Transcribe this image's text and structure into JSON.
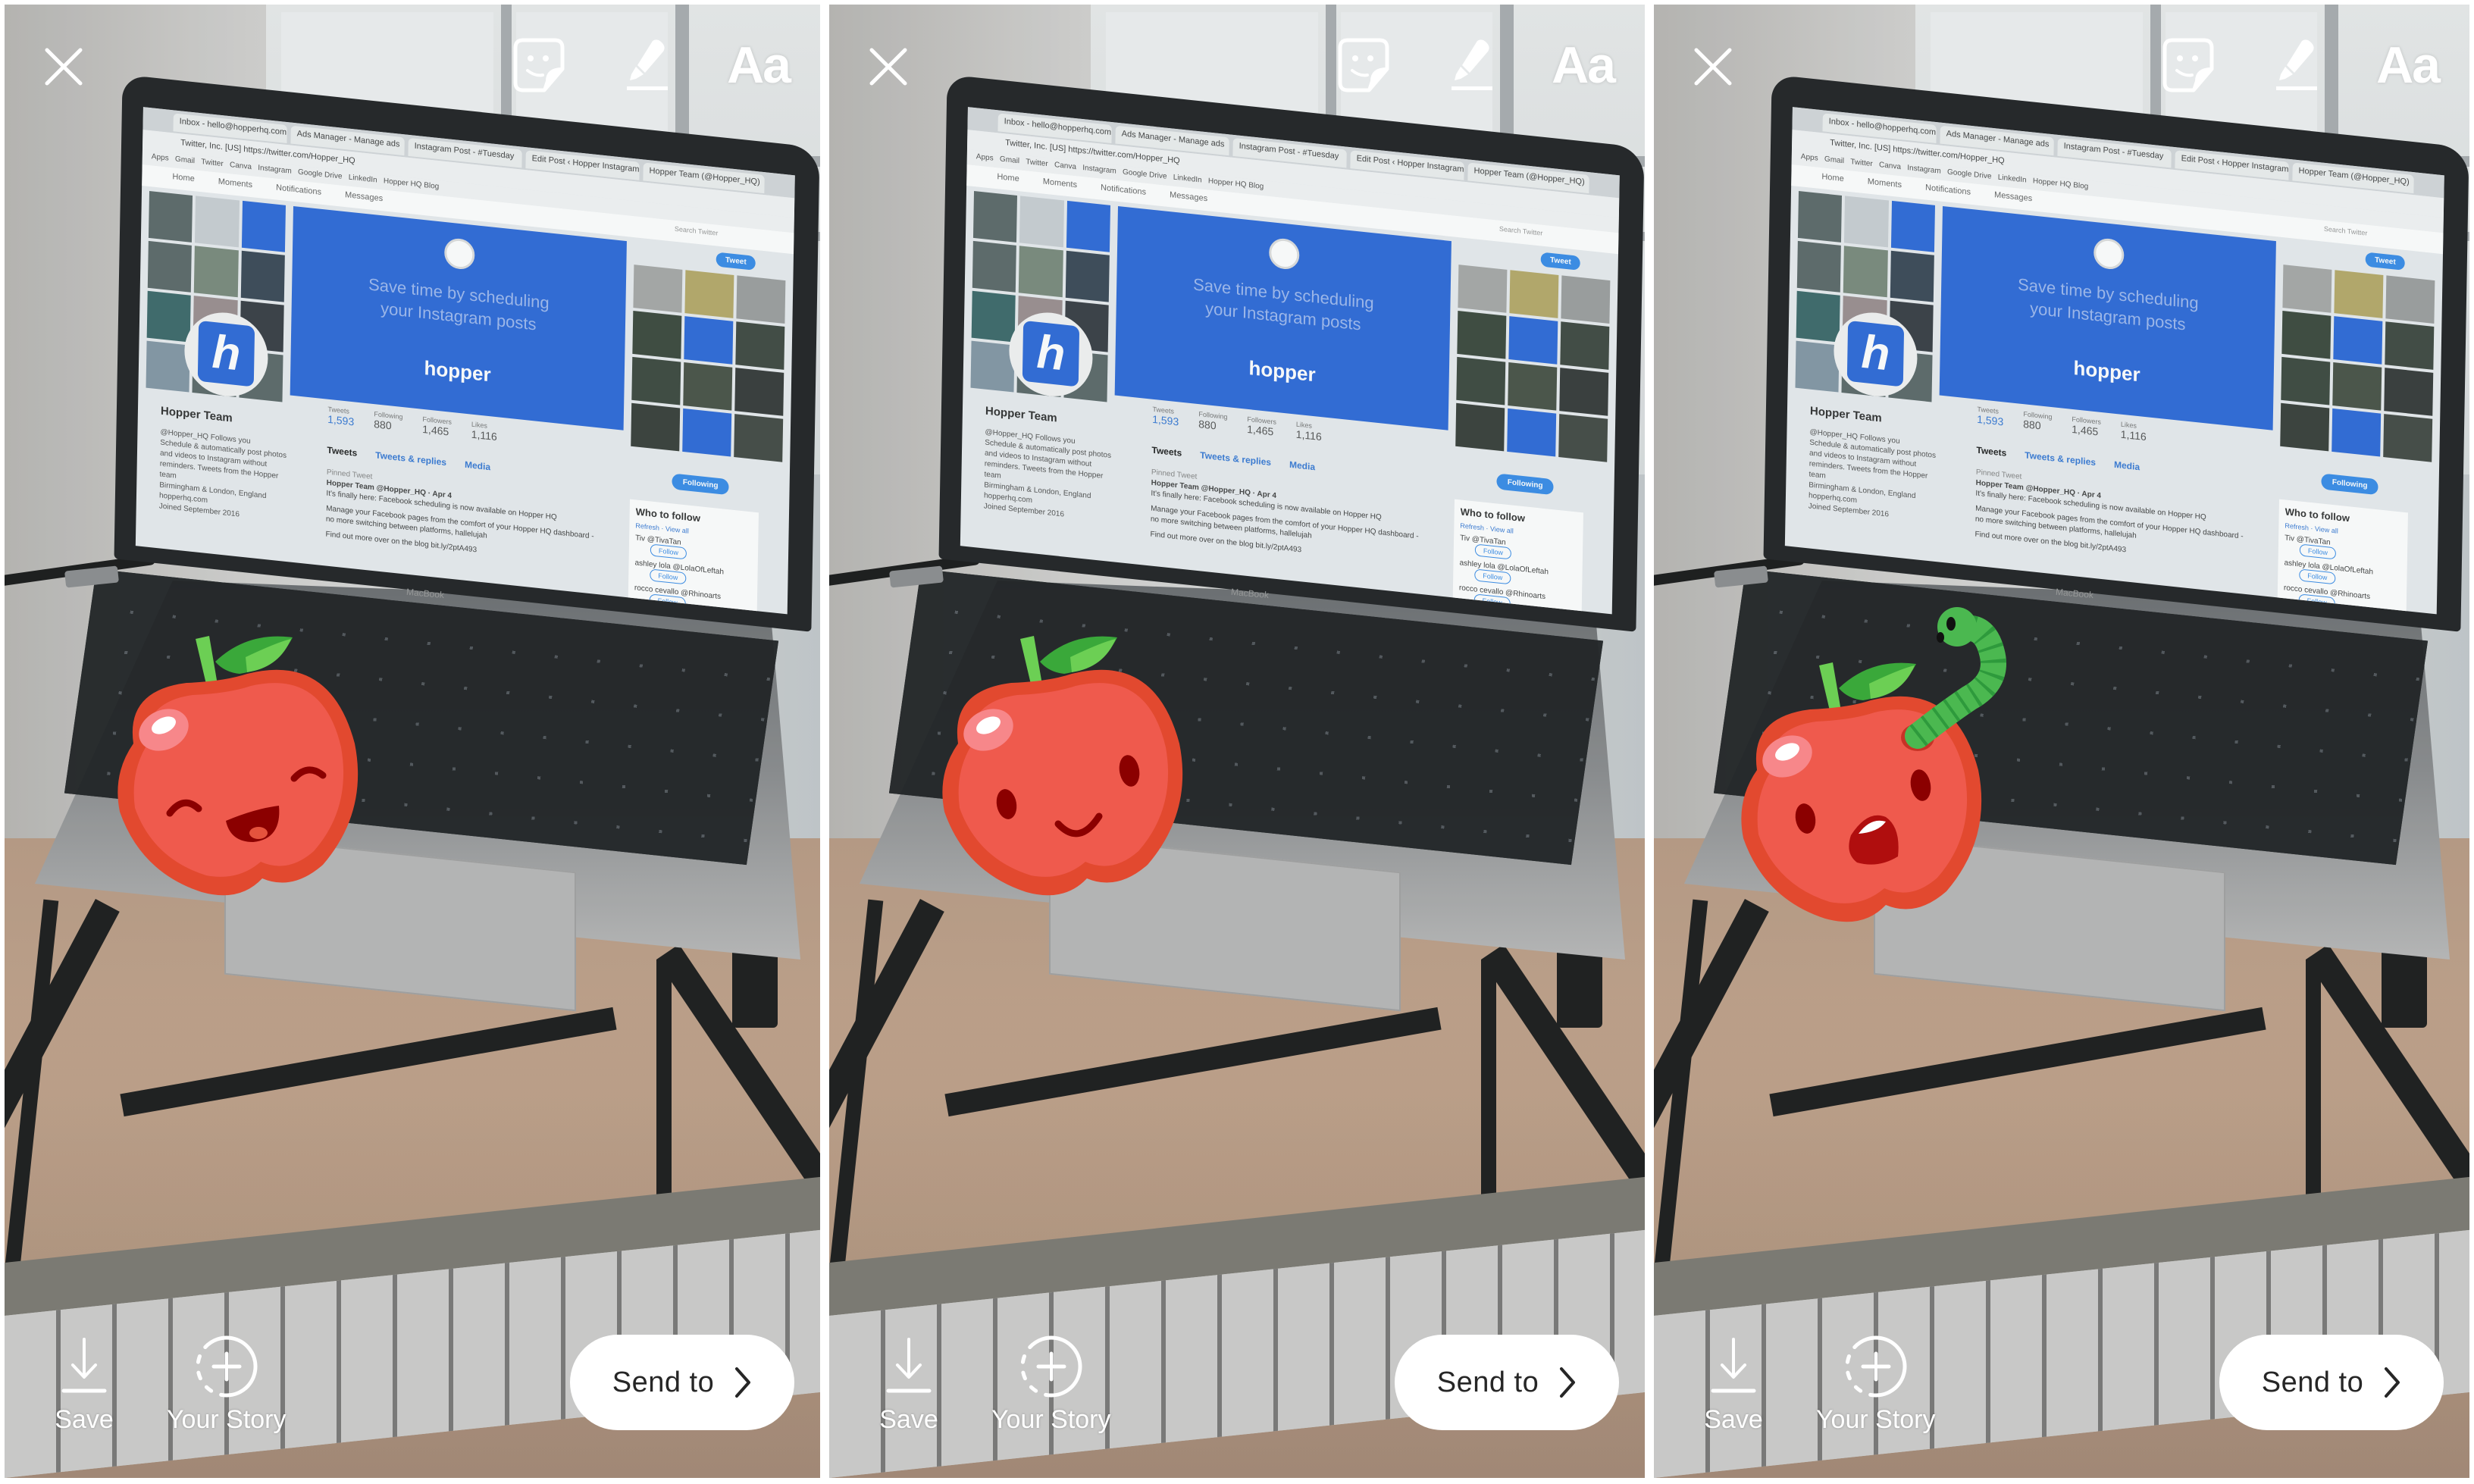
{
  "layout": {
    "panel_count": 3
  },
  "panels": [
    {
      "id": "panel-1",
      "sticker": {
        "name": "apple",
        "expression": "laughing",
        "has_worm": false
      }
    },
    {
      "id": "panel-2",
      "sticker": {
        "name": "apple",
        "expression": "smiling",
        "has_worm": false
      }
    },
    {
      "id": "panel-3",
      "sticker": {
        "name": "apple",
        "expression": "surprised",
        "has_worm": true
      }
    }
  ],
  "toolbar": {
    "close_icon": "close-icon",
    "sticker_icon": "sticker-icon",
    "draw_icon": "marker-pen-icon",
    "text_tool_label": "Aa"
  },
  "bottom_bar": {
    "save_label": "Save",
    "save_icon": "download-arrow-icon",
    "your_story_label": "Your Story",
    "your_story_icon": "add-story-icon",
    "send_to_label": "Send to",
    "send_to_icon": "chevron-right-icon"
  },
  "photo": {
    "browser": {
      "tabs": [
        "Inbox - hello@hopperhq.com",
        "Ads Manager - Manage ads",
        "Instagram Post - #Tuesday",
        "Edit Post ‹ Hopper Instagram",
        "Hopper Team (@Hopper_HQ)"
      ],
      "url": "Twitter, Inc. [US]  https://twitter.com/Hopper_HQ",
      "bookmarks": [
        "Apps",
        "Gmail",
        "Twitter",
        "Canva",
        "Instagram",
        "Google Drive",
        "LinkedIn",
        "Hopper HQ Blog"
      ]
    },
    "twitter": {
      "nav": [
        "Home",
        "Moments",
        "Notifications",
        "Messages"
      ],
      "search_placeholder": "Search Twitter",
      "tweet_button": "Tweet",
      "banner_line1": "Save time by scheduling",
      "banner_line2": "your Instagram posts",
      "banner_brand": "hopper",
      "avatar_letter": "h",
      "profile_name": "Hopper Team",
      "profile_handle": "@Hopper_HQ  Follows you",
      "profile_bio": "Schedule & automatically post photos and videos to Instagram without reminders. Tweets from the Hopper team",
      "location": "Birmingham & London, England",
      "website": "hopperhq.com",
      "joined": "Joined September 2016",
      "stats": [
        {
          "label": "Tweets",
          "value": "1,593"
        },
        {
          "label": "Following",
          "value": "880"
        },
        {
          "label": "Followers",
          "value": "1,465"
        },
        {
          "label": "Likes",
          "value": "1,116"
        }
      ],
      "tabs": [
        "Tweets",
        "Tweets & replies",
        "Media"
      ],
      "following_button": "Following",
      "tweet": {
        "pinned": "Pinned Tweet",
        "author": "Hopper Team @Hopper_HQ · Apr 4",
        "line1": "It's finally here: Facebook scheduling is now available on Hopper HQ",
        "line2": "Manage your Facebook pages from the comfort of your Hopper HQ dashboard - no more switching between platforms, hallelujah",
        "line3": "Find out more over on the blog bit.ly/2ptA493"
      },
      "who_to_follow": {
        "title": "Who to follow",
        "subtitle": "Refresh · View all",
        "follow_label": "Follow",
        "accounts": [
          "Tiv @TivaTan",
          "ashley lola @LolaOfLeftah",
          "rocco cevallo @Rhinoarts"
        ]
      }
    },
    "laptop_label": "MacBook"
  },
  "colors": {
    "apple_outer": "#e2492f",
    "apple_inner": "#ef5a4d",
    "apple_highlight": "#f7878a",
    "leaf_dark": "#3aa83a",
    "leaf_light": "#6ccf54",
    "face": "#8b0000",
    "worm": "#4bb850",
    "worm_stripe": "#2e9a3c",
    "twitter_blue": "#2f6bd8",
    "send_button_bg": "#ffffff",
    "send_button_text": "#262626"
  }
}
